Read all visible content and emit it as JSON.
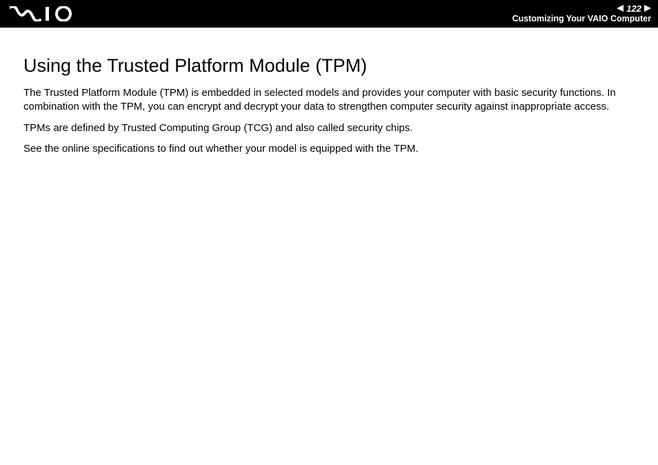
{
  "header": {
    "page_number": "122",
    "section": "Customizing Your VAIO Computer"
  },
  "content": {
    "heading": "Using the Trusted Platform Module (TPM)",
    "paragraphs": [
      "The Trusted Platform Module (TPM) is embedded in selected models and provides your computer with basic security functions. In combination with the TPM, you can encrypt and decrypt your data to strengthen computer security against inappropriate access.",
      "TPMs are defined by Trusted Computing Group (TCG) and also called security chips.",
      "See the online specifications to find out whether your model is equipped with the TPM."
    ]
  }
}
